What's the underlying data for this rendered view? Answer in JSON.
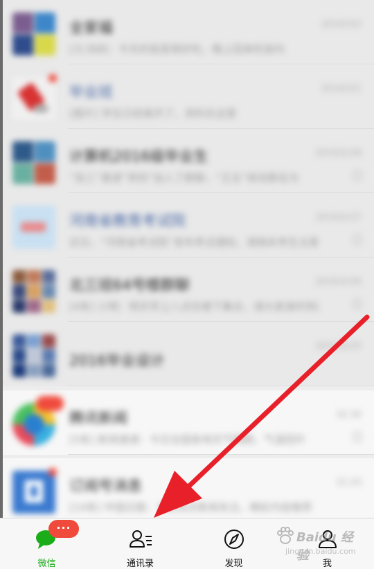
{
  "chats": [
    {
      "name": "全家福",
      "time": "2019/3/2",
      "preview": "[3] 妈妈：今天的饭菜很好吃，晚上回来吃饭吗",
      "name_style": "normal",
      "style": "pinned",
      "avatar": "group-grid",
      "muted": false
    },
    {
      "name": "毕业班",
      "time": "2019/3/1",
      "preview": "[图片] 学生已经离开了，资料在这里",
      "name_style": "blue",
      "style": "pinned",
      "avatar": "red-figure",
      "muted": false
    },
    {
      "name": "计算机2016级毕业生",
      "time": "2019/2/28",
      "preview": "“张三”邀请“李四”加入了群聊，“王五”修改群名为",
      "name_style": "normal",
      "style": "pinned",
      "avatar": "group-grid",
      "muted": true
    },
    {
      "name": "河南省教育考试院",
      "time": "2019/2/27",
      "preview": "近日，“河南省考试院”发布考试通知，请相关考生注意",
      "name_style": "blue",
      "style": "pinned",
      "avatar": "light-blue",
      "muted": true
    },
    {
      "name": "北三班64号楼群聊",
      "time": "2019/2/26",
      "preview": "[4条] 小明：明天早上八点在楼下集合，请大家准时到达",
      "name_style": "normal",
      "style": "pinned",
      "avatar": "group-grid",
      "muted": true
    },
    {
      "name": "2016毕业设计",
      "time": "2019/2/25",
      "preview": "",
      "name_style": "normal",
      "style": "pinned",
      "avatar": "group-grid",
      "muted": false
    },
    {
      "name": "腾讯新闻",
      "time": "16:30",
      "preview": "[5条] 新闻速递：今日全国各地天气晴朗，气温回升",
      "name_style": "normal",
      "style": "normal",
      "avatar": "colorful",
      "muted": true
    },
    {
      "name": "订阅号消息",
      "time": "15:20",
      "preview": "[14条] 中国日报：今日热点新闻关注，精彩内容推荐",
      "name_style": "normal",
      "style": "normal",
      "avatar": "blue-square",
      "muted": false
    }
  ],
  "tabbar": {
    "tabs": [
      {
        "label": "微信",
        "icon": "chat-bubble-icon",
        "active": true
      },
      {
        "label": "通讯录",
        "icon": "contacts-icon",
        "active": false
      },
      {
        "label": "发现",
        "icon": "compass-icon",
        "active": false
      },
      {
        "label": "我",
        "icon": "person-icon",
        "active": false
      }
    ],
    "badge": "···"
  },
  "watermark": {
    "brand": "Baidu 经验",
    "sub": "jingyan.baidu.com"
  },
  "colors": {
    "accent_green": "#1aad19",
    "badge_red": "#f04a3c",
    "arrow_red": "#e8202a",
    "tabbar_bg": "#f7f7f7"
  }
}
